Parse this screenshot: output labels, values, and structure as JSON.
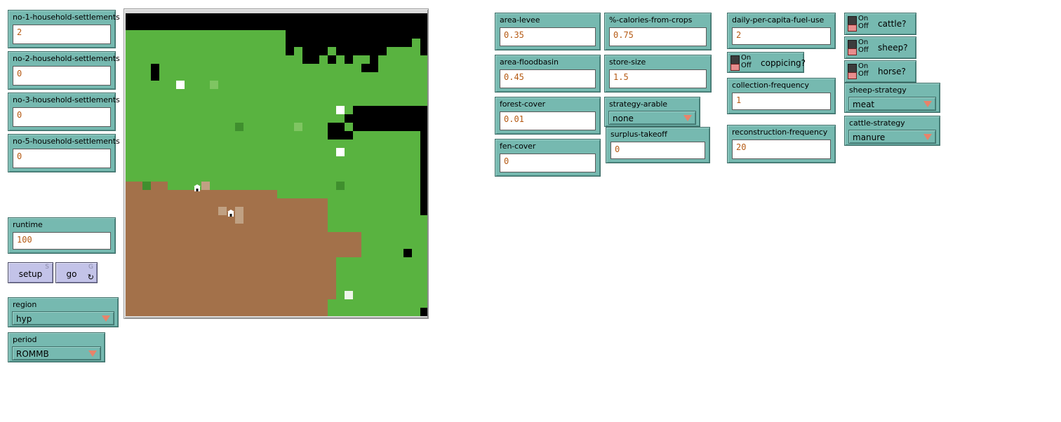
{
  "colors": {
    "panel_teal": "#76b9b0",
    "panel_border": "#3f6f69",
    "button_lavender": "#c3c3e8",
    "value_text": "#b55a14",
    "world_background": "#000000",
    "patch_green": "#59b340",
    "patch_green_light": "#7fc562",
    "patch_brown": "#a3714a",
    "patch_brown_light": "#c0a183",
    "patch_white": "#ffffff",
    "patch_green_dark": "#3f8f2e",
    "chooser_arrow": "#e8836a"
  },
  "settlement_inputs": [
    {
      "name": "no-1-household-settlements",
      "label": "no-1-household-settlements",
      "value": "2"
    },
    {
      "name": "no-2-household-settlements",
      "label": "no-2-household-settlements",
      "value": "0"
    },
    {
      "name": "no-3-household-settlements",
      "label": "no-3-household-settlements",
      "value": "0"
    },
    {
      "name": "no-5-household-settlements",
      "label": "no-5-household-settlements",
      "value": "0"
    }
  ],
  "runtime": {
    "label": "runtime",
    "value": "100"
  },
  "buttons": [
    {
      "name": "setup-button",
      "label": "setup",
      "shortcut": "S",
      "forever": false
    },
    {
      "name": "go-button",
      "label": "go",
      "shortcut": "G",
      "forever": true,
      "forever_icon": "↻"
    }
  ],
  "region_chooser": {
    "label": "region",
    "value": "hyp"
  },
  "period_chooser": {
    "label": "period",
    "value": "ROMMB"
  },
  "land_inputs": [
    {
      "name": "area-levee",
      "label": "area-levee",
      "value": "0.35"
    },
    {
      "name": "area-floodbasin",
      "label": "area-floodbasin",
      "value": "0.45"
    },
    {
      "name": "forest-cover",
      "label": "forest-cover",
      "value": "0.01"
    },
    {
      "name": "fen-cover",
      "label": "fen-cover",
      "value": "0"
    }
  ],
  "crop_inputs": [
    {
      "name": "pct-calories-from-crops",
      "label": "%-calories-from-crops",
      "value": "0.75"
    },
    {
      "name": "store-size",
      "label": "store-size",
      "value": "1.5"
    }
  ],
  "strategy_arable": {
    "label": "strategy-arable",
    "value": "none"
  },
  "surplus_takeoff": {
    "label": "surplus-takeoff",
    "value": "0"
  },
  "fuel_inputs": [
    {
      "name": "daily-per-capita-fuel-use",
      "label": "daily-per-capita-fuel-use",
      "value": "2"
    }
  ],
  "coppicing_switch": {
    "label": "coppicing?",
    "on_text": "On",
    "off_text": "Off",
    "state": "off"
  },
  "frequency_inputs": [
    {
      "name": "collection-frequency",
      "label": "collection-frequency",
      "value": "1"
    },
    {
      "name": "reconstruction-frequency",
      "label": "reconstruction-frequency",
      "value": "20"
    }
  ],
  "animal_switches": [
    {
      "name": "cattle-switch",
      "label": "cattle?",
      "on_text": "On",
      "off_text": "Off",
      "state": "off"
    },
    {
      "name": "sheep-switch",
      "label": "sheep?",
      "on_text": "On",
      "off_text": "Off",
      "state": "off"
    },
    {
      "name": "horse-switch",
      "label": "horse?",
      "on_text": "On",
      "off_text": "Off",
      "state": "off"
    }
  ],
  "sheep_strategy": {
    "label": "sheep-strategy",
    "value": "meat"
  },
  "cattle_strategy": {
    "label": "cattle-strategy",
    "value": "manure"
  },
  "world": {
    "name": "world-view",
    "patch_size": 12,
    "cols": 36,
    "rows": 36,
    "background": "#000000",
    "legend": {
      "K": "#000000",
      "G": "#59b340",
      "L": "#7fc562",
      "D": "#3f8f2e",
      "B": "#a3714a",
      "T": "#c0a183",
      "W": "#ffffff",
      "F": "#eef5ea"
    },
    "grid": [
      "KKKKKKKKKKKKKKKKKKKKKKKKKKKKKKKKKKKK",
      "KKKKKKKKKKKKKKKKKKKKKKKKKKKKKKKKKKKK",
      "GGGGGGGGGGGGGGGGGGGKKKKKKKKKKKKKKKKK",
      "GGGGGGGGGGGGGGGGGGGKKKKKKKKKKKKKKKGKK",
      "GGGGGGGGGGGGGGGGGGGKGKKKGKKKKKKGGGGKK",
      "GGGGGGGGGGGGGGGGGGGGGKKGKGKGGKGGGGGGG",
      "GGGKGGGGGGGGGGGGGGGGGGGGGGGGKKGGGGGGG",
      "GGGKGGGGGGGGGGGGGGGGGGGGGGGGGGGGGGGGG",
      "GGGGGGGGGGGGGGGGGGGGGGGGGGGGGGGGGGGGG",
      "GGGGGGGGGGGGGGGGGGGGGGGGGGGGGGGGGGGGG",
      "GGGGGGGGGGGGGGGGGGGGGGGGGGGGGGGGGGGGG",
      "GGGGGGGGGGGGGGGGGGGGGGGGGGGKKKKKKKKKK",
      "GGGGGGGGGGGGGGGGGGGGGGGGGGKKKKKKKKKKK",
      "GGGGGGGGGGGGGGGGGGGGGGGGKKGKKKKKKKKKK",
      "GGGGGGGGGGGGGGGGGGGGGGGGKKKGGGGGGGGKK",
      "GGGGGGGGGGGGGGGGGGGGGGGGGGGGGGGGGGGKK",
      "GGGGGGGGGGGGGGGGGGGGGGGGGGGGGGGGGGGKK",
      "GGGGGGGGGGGGGGGGGGGGGGGGGGGGGGGGGGGKK",
      "GGGGGGGGGGGGGGGGGGGGGGGGGGGGGGGGGGGKK",
      "GGGGGGGGGGGGGGGGGGGGGGGGGGGGGGGGGGGKK",
      "BBBBBGGGGGGGGGGGGGGGGGGGGGGGGGGGGGGKK",
      "BBBBBBBBBBBBBBBBBBGGGGGGGGGGGGGGGGGKK",
      "BBBBBBBBBBBBBBBBBBBBBBBBGGGGGGGGGGGKK",
      "BBBBBBBBBBBBBBBBBBBBBBBBGGGGGGGGGGGKK",
      "BBBBBBBBBBBBBBBBBBBBBBBBGGGGGGGGGGGGK",
      "BBBBBBBBBBBBBBBBBBBBBBBBGGGGGGGGGGGGG",
      "BBBBBBBBBBBBBBBBBBBBBBBBBBBBGGGGGGGGG",
      "BBBBBBBBBBBBBBBBBBBBBBBBBBBBGGGGGGGGG",
      "BBBBBBBBBBBBBBBBBBBBBBBBBBBBGGGGGGGGG",
      "BBBBBBBBBBBBBBBBBBBBBBBBBGGGGGGGGGGGG",
      "BBBBBBBBBBBBBBBBBBBBBBBBBGGGGGGGGGGGG",
      "BBBBBBBBBBBBBBBBBBBBBBBBBGGGGGGGGGGGG",
      "BBBBBBBBBBBBBBBBBBBBBBBBBGGGGGGGGGGGG",
      "BBBBBBBBBBBBBBBBBBBBBBBBBGGGGGGGGGGGG",
      "BBBBBBBBBBBBBBBBBBBBBBBBGGGGGGGGGGGGG",
      "BBBBBBBBBBBBBBBBBBBBBBBBGGGGGGGGGGGGG"
    ],
    "overlay_patches": [
      {
        "name": "white-patch",
        "col": 6,
        "row": 8,
        "color": "#ffffff"
      },
      {
        "name": "light-green-patch",
        "col": 10,
        "row": 8,
        "color": "#7fc562"
      },
      {
        "name": "green-dark-patch",
        "col": 13,
        "row": 13,
        "color": "#3f8f2e"
      },
      {
        "name": "light-green-patch",
        "col": 20,
        "row": 13,
        "color": "#7fc562"
      },
      {
        "name": "white-patch",
        "col": 25,
        "row": 11,
        "color": "#ffffff"
      },
      {
        "name": "white-patch",
        "col": 25,
        "row": 16,
        "color": "#ffffff"
      },
      {
        "name": "white-patch",
        "col": 26,
        "row": 33,
        "color": "#eef5ea"
      },
      {
        "name": "green-dark-patch",
        "col": 2,
        "row": 20,
        "color": "#3f8f2e"
      },
      {
        "name": "green-dark-patch",
        "col": 25,
        "row": 20,
        "color": "#3f8f2e"
      },
      {
        "name": "field-patch",
        "col": 9,
        "row": 20,
        "color": "#c0a183"
      },
      {
        "name": "field-patch",
        "col": 11,
        "row": 23,
        "color": "#c0a183"
      },
      {
        "name": "field-patch",
        "col": 13,
        "row": 23,
        "color": "#c0a183"
      },
      {
        "name": "field-patch",
        "col": 13,
        "row": 24,
        "color": "#c0a183"
      },
      {
        "name": "black-patch",
        "col": 33,
        "row": 28,
        "color": "#000000"
      },
      {
        "name": "black-patch",
        "col": 35,
        "row": 35,
        "color": "#000000"
      }
    ],
    "settlements": [
      {
        "name": "settlement-house",
        "col": 8,
        "row": 20
      },
      {
        "name": "settlement-house",
        "col": 12,
        "row": 23
      }
    ]
  }
}
